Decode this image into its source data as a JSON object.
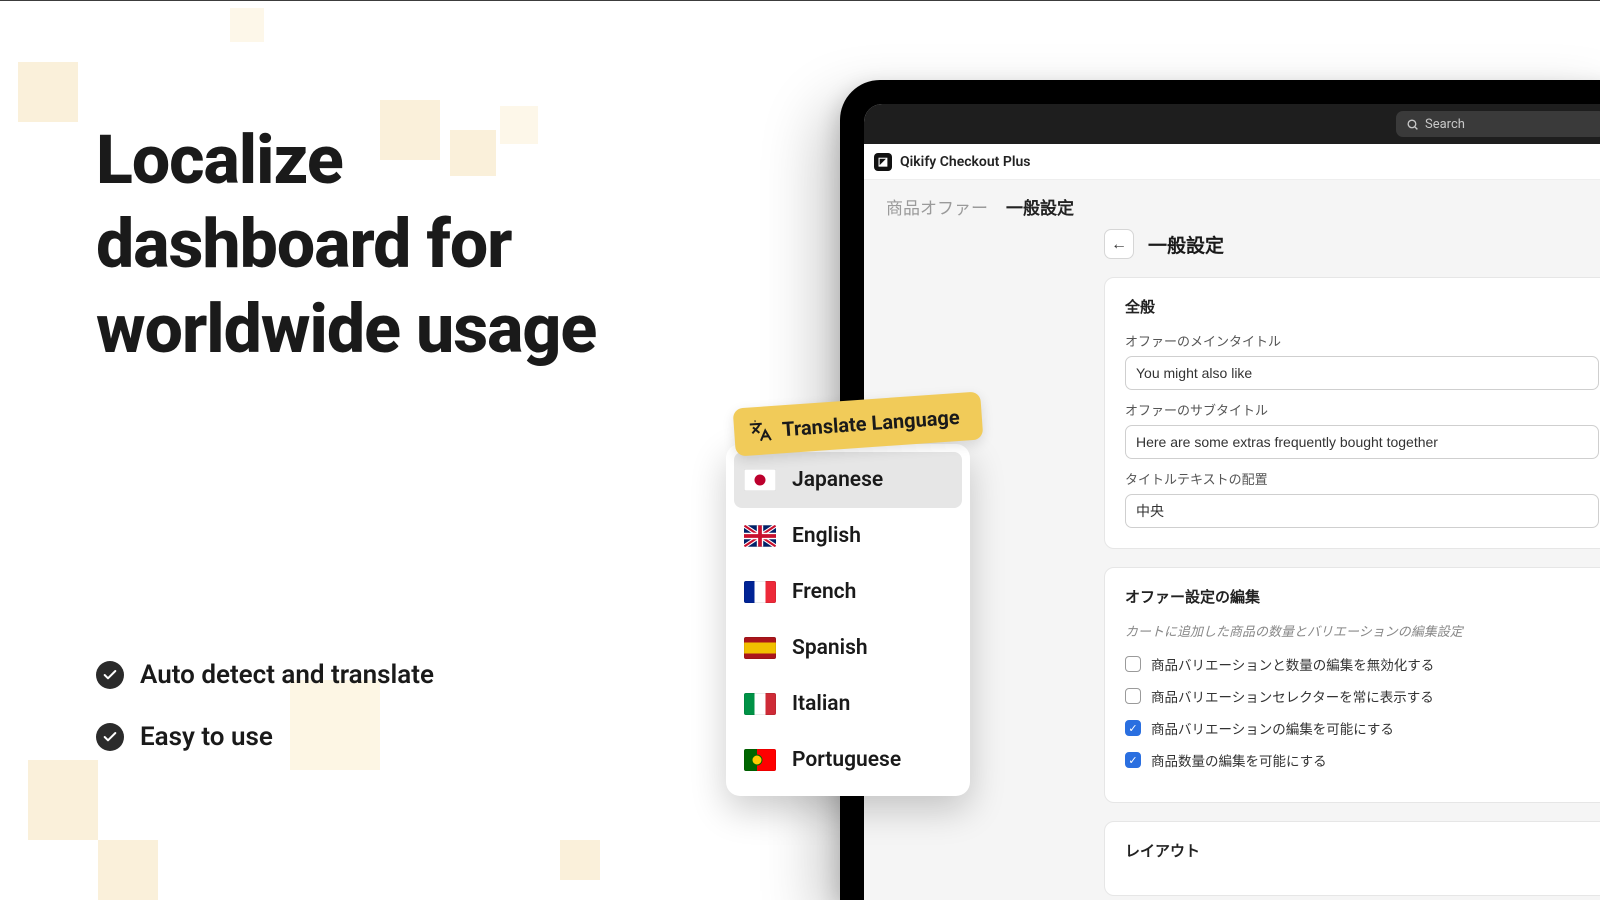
{
  "marketing": {
    "headline": "Localize dashboard for worldwide usage",
    "features": [
      "Auto detect and translate",
      "Easy to use"
    ]
  },
  "languagePicker": {
    "title": "Translate Language",
    "items": [
      {
        "label": "Japanese",
        "flag": "jp",
        "selected": true
      },
      {
        "label": "English",
        "flag": "uk",
        "selected": false
      },
      {
        "label": "French",
        "flag": "fr",
        "selected": false
      },
      {
        "label": "Spanish",
        "flag": "es",
        "selected": false
      },
      {
        "label": "Italian",
        "flag": "it",
        "selected": false
      },
      {
        "label": "Portuguese",
        "flag": "pt",
        "selected": false
      }
    ]
  },
  "app": {
    "searchPlaceholder": "Search",
    "name": "Qikify Checkout Plus",
    "tabs": {
      "offers": "商品オファー",
      "general": "一般設定"
    },
    "pageTitle": "一般設定",
    "card1": {
      "title": "全般",
      "mainTitleLabel": "オファーのメインタイトル",
      "mainTitleValue": "You might also like",
      "subTitleLabel": "オファーのサブタイトル",
      "subTitleValue": "Here are some extras frequently bought together",
      "alignLabel": "タイトルテキストの配置",
      "alignValue": "中央"
    },
    "card2": {
      "title": "オファー設定の編集",
      "subtitle": "カートに追加した商品の数量とバリエーションの編集設定",
      "cb1": "商品バリエーションと数量の編集を無効化する",
      "cb2": "商品バリエーションセレクターを常に表示する",
      "cb3": "商品バリエーションの編集を可能にする",
      "cb4": "商品数量の編集を可能にする"
    },
    "card3": {
      "title": "レイアウト"
    }
  }
}
